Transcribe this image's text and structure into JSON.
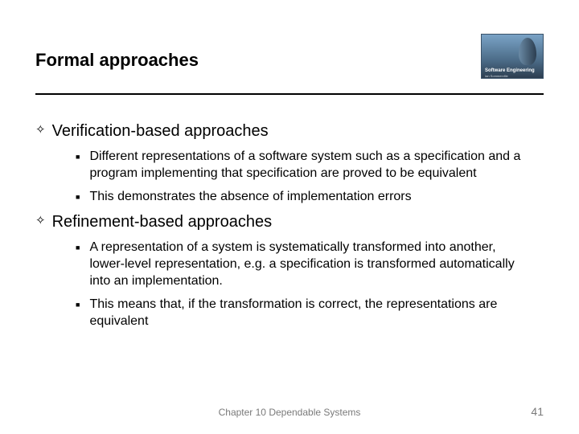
{
  "header": {
    "title": "Formal approaches",
    "logo_text": "Software Engineering",
    "logo_sub": "Ian Sommerville"
  },
  "sections": [
    {
      "heading": "Verification-based approaches",
      "bullets": [
        "Different representations of a software system such as a specification and a program implementing that specification are proved to be equivalent",
        "This demonstrates the absence of implementation errors"
      ]
    },
    {
      "heading": "Refinement-based approaches",
      "bullets": [
        "A representation of a system is systematically transformed into another, lower-level representation, e.g. a specification is transformed automatically into an implementation.",
        "This means that, if the transformation is correct, the representations are equivalent"
      ]
    }
  ],
  "footer": {
    "chapter": "Chapter 10 Dependable Systems",
    "page": "41"
  }
}
